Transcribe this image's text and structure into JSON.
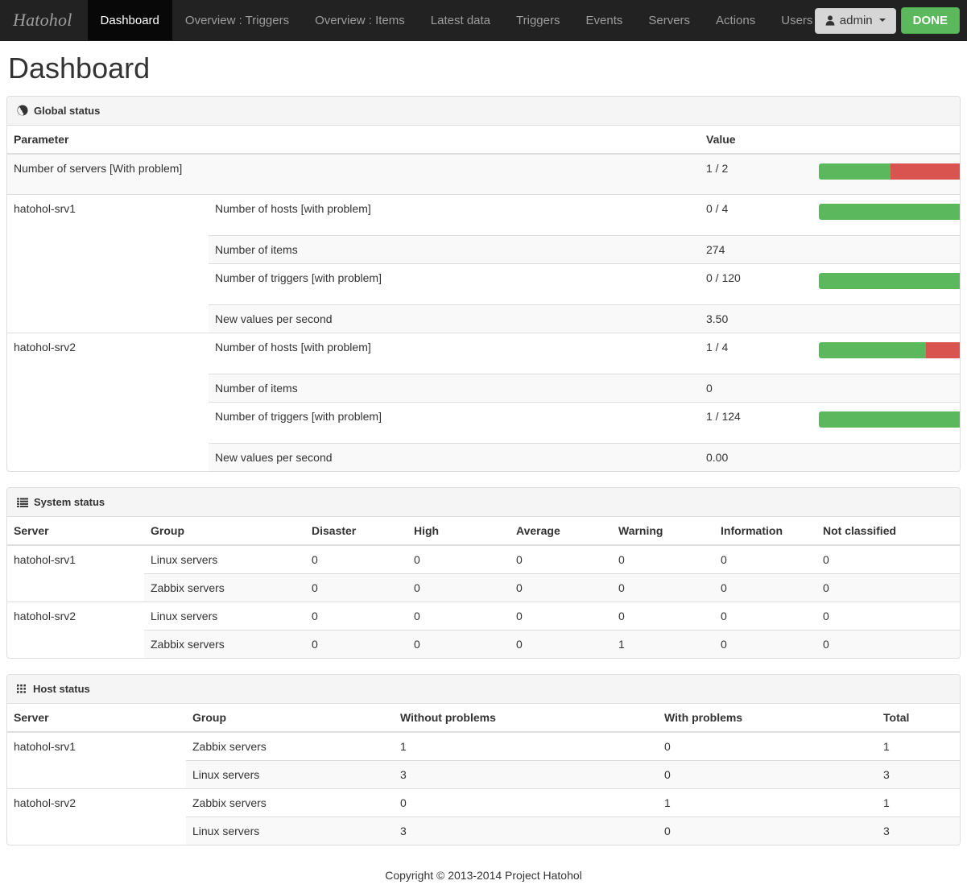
{
  "navbar": {
    "brand": "Hatohol",
    "items": [
      {
        "label": "Dashboard",
        "active": true
      },
      {
        "label": "Overview : Triggers",
        "active": false
      },
      {
        "label": "Overview : Items",
        "active": false
      },
      {
        "label": "Latest data",
        "active": false
      },
      {
        "label": "Triggers",
        "active": false
      },
      {
        "label": "Events",
        "active": false
      },
      {
        "label": "Servers",
        "active": false
      },
      {
        "label": "Actions",
        "active": false
      },
      {
        "label": "Users",
        "active": false
      }
    ],
    "user_label": "admin",
    "done_label": "DONE"
  },
  "page_title": "Dashboard",
  "global_status": {
    "heading": "Global status",
    "heading_icon": "globe-icon",
    "columns": [
      "Parameter",
      "Value"
    ],
    "summary": {
      "parameter": "Number of servers [With problem]",
      "value": "1 / 2",
      "ok_percent": 50,
      "ng_percent": 50
    },
    "servers": [
      {
        "name": "hatohol-srv1",
        "rows": [
          {
            "parameter": "Number of hosts [with problem]",
            "value": "0 / 4",
            "ok_percent": 100,
            "ng_percent": 0,
            "has_bar": true
          },
          {
            "parameter": "Number of items",
            "value": "274",
            "has_bar": false
          },
          {
            "parameter": "Number of triggers [with problem]",
            "value": "0 / 120",
            "ok_percent": 100,
            "ng_percent": 0,
            "has_bar": true
          },
          {
            "parameter": "New values per second",
            "value": "3.50",
            "has_bar": false
          }
        ]
      },
      {
        "name": "hatohol-srv2",
        "rows": [
          {
            "parameter": "Number of hosts [with problem]",
            "value": "1 / 4",
            "ok_percent": 75,
            "ng_percent": 25,
            "has_bar": true
          },
          {
            "parameter": "Number of items",
            "value": "0",
            "has_bar": false
          },
          {
            "parameter": "Number of triggers [with problem]",
            "value": "1 / 124",
            "ok_percent": 99.2,
            "ng_percent": 0.8,
            "has_bar": true
          },
          {
            "parameter": "New values per second",
            "value": "0.00",
            "has_bar": false
          }
        ]
      }
    ]
  },
  "system_status": {
    "heading": "System status",
    "heading_icon": "list-icon",
    "columns": [
      "Server",
      "Group",
      "Disaster",
      "High",
      "Average",
      "Warning",
      "Information",
      "Not classified"
    ],
    "servers": [
      {
        "name": "hatohol-srv1",
        "rows": [
          {
            "group": "Linux servers",
            "values": [
              "0",
              "0",
              "0",
              "0",
              "0",
              "0"
            ]
          },
          {
            "group": "Zabbix servers",
            "values": [
              "0",
              "0",
              "0",
              "0",
              "0",
              "0"
            ]
          }
        ]
      },
      {
        "name": "hatohol-srv2",
        "rows": [
          {
            "group": "Linux servers",
            "values": [
              "0",
              "0",
              "0",
              "0",
              "0",
              "0"
            ]
          },
          {
            "group": "Zabbix servers",
            "values": [
              "0",
              "0",
              "0",
              "1",
              "0",
              "0"
            ]
          }
        ]
      }
    ]
  },
  "host_status": {
    "heading": "Host status",
    "heading_icon": "grid-icon",
    "columns": [
      "Server",
      "Group",
      "Without problems",
      "With problems",
      "Total"
    ],
    "servers": [
      {
        "name": "hatohol-srv1",
        "rows": [
          {
            "group": "Zabbix servers",
            "values": [
              "1",
              "0",
              "1"
            ]
          },
          {
            "group": "Linux servers",
            "values": [
              "3",
              "0",
              "3"
            ]
          }
        ]
      },
      {
        "name": "hatohol-srv2",
        "rows": [
          {
            "group": "Zabbix servers",
            "values": [
              "0",
              "1",
              "1"
            ]
          },
          {
            "group": "Linux servers",
            "values": [
              "3",
              "0",
              "3"
            ]
          }
        ]
      }
    ]
  },
  "footer": "Copyright © 2013-2014 Project Hatohol",
  "colors": {
    "ok": "#5cb85c",
    "problem": "#d9534f",
    "navbar": "#222222",
    "navbar_active": "#080808"
  }
}
